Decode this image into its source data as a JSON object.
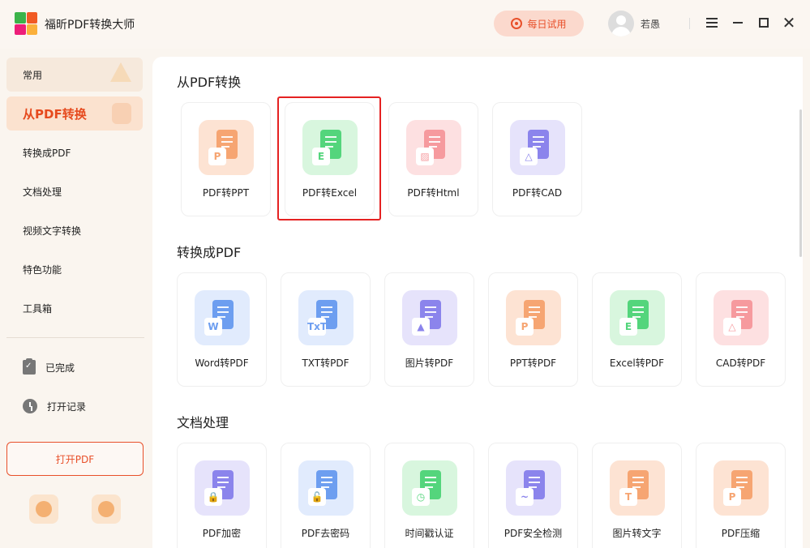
{
  "app": {
    "title": "福昕PDF转换大师",
    "trial_label": "每日试用",
    "username": "若愚"
  },
  "sidebar": {
    "items": [
      {
        "label": "常用"
      },
      {
        "label": "从PDF转换"
      },
      {
        "label": "转换成PDF"
      },
      {
        "label": "文档处理"
      },
      {
        "label": "视频文字转换"
      },
      {
        "label": "特色功能"
      },
      {
        "label": "工具箱"
      }
    ],
    "completed_label": "已完成",
    "history_label": "打开记录",
    "open_pdf_label": "打开PDF"
  },
  "sections": [
    {
      "title": "从PDF转换",
      "cards": [
        {
          "label": "PDF转PPT",
          "tile": "#fde3d3",
          "doc": "#f6a572",
          "badge": "P",
          "badge_color": "#f6a572"
        },
        {
          "label": "PDF转Excel",
          "tile": "#d8f6de",
          "doc": "#54d57c",
          "badge": "E",
          "badge_color": "#54d57c"
        },
        {
          "label": "PDF转Html",
          "tile": "#fde0e1",
          "doc": "#f69a9e",
          "badge": "▨",
          "badge_color": "#f69a9e"
        },
        {
          "label": "PDF转CAD",
          "tile": "#e6e3fb",
          "doc": "#8b84ec",
          "badge": "△",
          "badge_color": "#8b84ec"
        }
      ]
    },
    {
      "title": "转换成PDF",
      "cards": [
        {
          "label": "Word转PDF",
          "tile": "#e1ebfd",
          "doc": "#6d9ef0",
          "badge": "W",
          "badge_color": "#6d9ef0"
        },
        {
          "label": "TXT转PDF",
          "tile": "#e1ebfd",
          "doc": "#6d9ef0",
          "badge": "TxT",
          "badge_color": "#6d9ef0"
        },
        {
          "label": "图片转PDF",
          "tile": "#e6e3fb",
          "doc": "#8b84ec",
          "badge": "▲",
          "badge_color": "#8b84ec"
        },
        {
          "label": "PPT转PDF",
          "tile": "#fde3d3",
          "doc": "#f6a572",
          "badge": "P",
          "badge_color": "#f6a572"
        },
        {
          "label": "Excel转PDF",
          "tile": "#d8f6de",
          "doc": "#54d57c",
          "badge": "E",
          "badge_color": "#54d57c"
        },
        {
          "label": "CAD转PDF",
          "tile": "#fde0e1",
          "doc": "#f69a9e",
          "badge": "△",
          "badge_color": "#f69a9e"
        }
      ]
    },
    {
      "title": "文档处理",
      "cards": [
        {
          "label": "PDF加密",
          "tile": "#e6e3fb",
          "doc": "#8b84ec",
          "badge": "🔒",
          "badge_color": "#8b84ec"
        },
        {
          "label": "PDF去密码",
          "tile": "#e1ebfd",
          "doc": "#6d9ef0",
          "badge": "🔓",
          "badge_color": "#6d9ef0"
        },
        {
          "label": "时间戳认证",
          "tile": "#d8f6de",
          "doc": "#54d57c",
          "badge": "◷",
          "badge_color": "#54d57c"
        },
        {
          "label": "PDF安全检测",
          "tile": "#e6e3fb",
          "doc": "#8b84ec",
          "badge": "~",
          "badge_color": "#8b84ec"
        },
        {
          "label": "图片转文字",
          "tile": "#fde3d3",
          "doc": "#f6a572",
          "badge": "T",
          "badge_color": "#f6a572"
        },
        {
          "label": "PDF压缩",
          "tile": "#fde3d3",
          "doc": "#f6a572",
          "badge": "P",
          "badge_color": "#f6a572"
        }
      ]
    }
  ]
}
